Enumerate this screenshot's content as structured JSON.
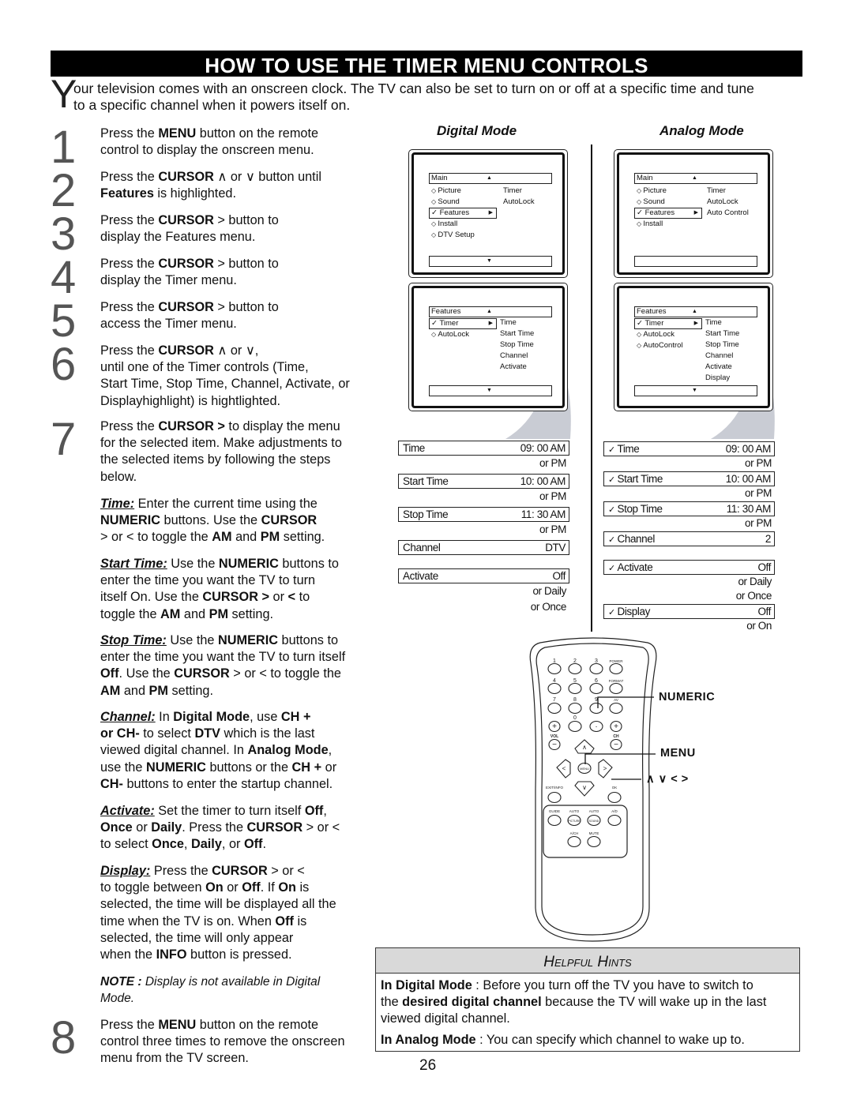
{
  "title": "HOW TO USE THE TIMER MENU CONTROLS",
  "intro": {
    "dropcap": "Y",
    "text": "our television comes with an onscreen clock. The TV can also be set to turn on or off at a specific time and tune\nto a specific channel when it powers itself on."
  },
  "steps": [
    {
      "num": "1",
      "text": [
        [
          "Press the ",
          ""
        ],
        [
          "MENU",
          "b"
        ],
        [
          " button on the remote\ncontrol to display the onscreen menu.",
          ""
        ]
      ]
    },
    {
      "num": "2",
      "text": [
        [
          "Press the ",
          ""
        ],
        [
          "CURSOR",
          "b"
        ],
        [
          " ∧  or ∨ button until\n",
          ""
        ],
        [
          "Features",
          "b"
        ],
        [
          " is highlighted.",
          ""
        ]
      ]
    },
    {
      "num": "3",
      "text": [
        [
          "Press the ",
          ""
        ],
        [
          "CURSOR",
          "b"
        ],
        [
          " > button to\ndisplay the Features menu.",
          ""
        ]
      ]
    },
    {
      "num": "4",
      "text": [
        [
          "Press the ",
          ""
        ],
        [
          "CURSOR",
          "b"
        ],
        [
          " > button to\ndisplay the Timer menu.",
          ""
        ]
      ]
    },
    {
      "num": "5",
      "text": [
        [
          "Press the ",
          ""
        ],
        [
          "CURSOR",
          "b"
        ],
        [
          " > button to\naccess the Timer menu.",
          ""
        ]
      ]
    },
    {
      "num": "6",
      "text": [
        [
          "Press the ",
          ""
        ],
        [
          "CURSOR",
          "b"
        ],
        [
          " ∧  or ∨,\nuntil one of the Timer controls (Time,\nStart Time, Stop Time, Channel, Activate, or\nDisplayhighlight) is hightlighted.",
          ""
        ]
      ]
    },
    {
      "num": "7",
      "text": [
        [
          "Press the ",
          ""
        ],
        [
          "CURSOR >",
          "b"
        ],
        [
          " to display the menu\nfor the selected item.  Make adjustments to\nthe selected items by following the steps\nbelow.",
          ""
        ]
      ]
    },
    {
      "num": "8",
      "text": [
        [
          "Press the ",
          ""
        ],
        [
          "MENU",
          "b"
        ],
        [
          " button on the remote\ncontrol three times to remove the onscreen\nmenu from the TV screen.",
          ""
        ]
      ]
    }
  ],
  "details": {
    "time": [
      [
        "Time:",
        "bu"
      ],
      [
        " Enter the current time using the\n",
        ""
      ],
      [
        "NUMERIC",
        "b"
      ],
      [
        " buttons. Use the ",
        ""
      ],
      [
        "CURSOR",
        "b"
      ],
      [
        "\n> or < to toggle the ",
        ""
      ],
      [
        "AM",
        "b"
      ],
      [
        " and ",
        ""
      ],
      [
        "PM",
        "b"
      ],
      [
        " setting.",
        ""
      ]
    ],
    "start_time": [
      [
        "Start Time:",
        "bu"
      ],
      [
        " Use the ",
        ""
      ],
      [
        "NUMERIC",
        "b"
      ],
      [
        " buttons to\nenter     the time you want the TV to turn\nitself On.  Use the ",
        ""
      ],
      [
        "CURSOR >",
        "b"
      ],
      [
        " or ",
        ""
      ],
      [
        "<",
        "b"
      ],
      [
        " to\ntoggle the ",
        ""
      ],
      [
        "AM",
        "b"
      ],
      [
        " and ",
        ""
      ],
      [
        "PM",
        "b"
      ],
      [
        " setting.",
        ""
      ]
    ],
    "stop_time": [
      [
        "Stop Time:",
        "bu"
      ],
      [
        " Use the ",
        ""
      ],
      [
        "NUMERIC",
        "b"
      ],
      [
        " buttons to\nenter the time you want the TV to turn itself\n",
        ""
      ],
      [
        "Off",
        "b"
      ],
      [
        ". Use the ",
        ""
      ],
      [
        "CURSOR",
        "b"
      ],
      [
        " > or < to toggle the\n",
        ""
      ],
      [
        "AM",
        "b"
      ],
      [
        " and ",
        ""
      ],
      [
        "PM",
        "b"
      ],
      [
        " setting.",
        ""
      ]
    ],
    "channel": [
      [
        "Channel:",
        "bu"
      ],
      [
        "  In ",
        ""
      ],
      [
        "Digital Mode",
        "b"
      ],
      [
        ", use ",
        ""
      ],
      [
        "CH +\nor CH-",
        "b"
      ],
      [
        "  to select ",
        ""
      ],
      [
        "DTV",
        "b"
      ],
      [
        " which is the last\nviewed digital channel.   In ",
        ""
      ],
      [
        "Analog Mode",
        "b"
      ],
      [
        ",\nuse the ",
        ""
      ],
      [
        "NUMERIC",
        "b"
      ],
      [
        " buttons or the ",
        ""
      ],
      [
        "CH +",
        "b"
      ],
      [
        " or\n",
        ""
      ],
      [
        "CH-",
        "b"
      ],
      [
        " buttons to enter the startup channel.",
        ""
      ]
    ],
    "activate": [
      [
        "Activate:",
        "bu"
      ],
      [
        " Set the timer to turn itself ",
        ""
      ],
      [
        "Off",
        "b"
      ],
      [
        ",\n",
        ""
      ],
      [
        "Once",
        "b"
      ],
      [
        " or ",
        ""
      ],
      [
        "Daily",
        "b"
      ],
      [
        ". Press the ",
        ""
      ],
      [
        "CURSOR",
        "b"
      ],
      [
        " > or <\nto select ",
        ""
      ],
      [
        "Once",
        "b"
      ],
      [
        ", ",
        ""
      ],
      [
        "Daily",
        "b"
      ],
      [
        ", or ",
        ""
      ],
      [
        "Off",
        "b"
      ],
      [
        ".",
        ""
      ]
    ],
    "display": [
      [
        "Display:",
        "bu"
      ],
      [
        " Press the ",
        ""
      ],
      [
        "CURSOR",
        "b"
      ],
      [
        " > or <\nto toggle between ",
        ""
      ],
      [
        "On",
        "b"
      ],
      [
        " or ",
        ""
      ],
      [
        "Off",
        "b"
      ],
      [
        ".  If ",
        ""
      ],
      [
        "On",
        "b"
      ],
      [
        " is\nselected, the time will be displayed all the\ntime when the TV is on.   When ",
        ""
      ],
      [
        "Off",
        "b"
      ],
      [
        " is\nselected, the time will only appear\nwhen the ",
        ""
      ],
      [
        "INFO",
        "b"
      ],
      [
        " button is pressed.",
        ""
      ]
    ],
    "note": [
      [
        "NOTE :",
        "bi"
      ],
      [
        " Display is not available in Digital\nMode.",
        "i"
      ]
    ]
  },
  "modes": {
    "digital": "Digital Mode",
    "analog": "Analog Mode"
  },
  "screens": {
    "digital_main": {
      "header": "Main",
      "items": [
        [
          "◇",
          "Picture",
          false
        ],
        [
          "◇",
          "Sound",
          false
        ],
        [
          "✓",
          "Features",
          true
        ],
        [
          "◇",
          "Install",
          false
        ],
        [
          "◇",
          "DTV Setup",
          false
        ]
      ],
      "right": [
        "Timer",
        "AutoLock"
      ],
      "bottom_arrow": true
    },
    "digital_features": {
      "header": "Features",
      "items": [
        [
          "✓",
          "Timer",
          true
        ],
        [
          "◇",
          "AutoLock",
          false
        ]
      ],
      "right": [
        "Time",
        "Start Time",
        "Stop Time",
        "Channel",
        "Activate"
      ],
      "bottom_arrow": true
    },
    "analog_main": {
      "header": "Main",
      "items": [
        [
          "◇",
          "Picture",
          false
        ],
        [
          "◇",
          "Sound",
          false
        ],
        [
          "✓",
          "Features",
          true
        ],
        [
          "◇",
          "Install",
          false
        ]
      ],
      "right": [
        "Timer",
        "AutoLock",
        "Auto Control"
      ],
      "bottom_arrow": false
    },
    "analog_features": {
      "header": "Features",
      "items": [
        [
          "✓",
          "Timer",
          true
        ],
        [
          "◇",
          "AutoLock",
          false
        ],
        [
          "◇",
          "AutoControl",
          false
        ]
      ],
      "right": [
        "Time",
        "Start Time",
        "Stop Time",
        "Channel",
        "Activate",
        "Display"
      ],
      "bottom_arrow": true
    }
  },
  "settings": {
    "digital": [
      {
        "label": "Time",
        "value": "09: 00 AM",
        "alts": [
          "or PM"
        ]
      },
      {
        "label": "Start Time",
        "value": "10: 00 AM",
        "alts": [
          "or PM"
        ]
      },
      {
        "label": "Stop Time",
        "value": "11: 30 AM",
        "alts": [
          "or PM"
        ]
      },
      {
        "label": "Channel",
        "value": "DTV",
        "alts": []
      },
      {
        "label": "Activate",
        "value": "Off",
        "alts": [
          "or Daily",
          "or Once"
        ]
      }
    ],
    "analog": [
      {
        "label": "Time",
        "value": "09: 00 AM",
        "alts": [
          "or PM"
        ]
      },
      {
        "label": "Start Time",
        "value": "10: 00 AM",
        "alts": [
          "or PM"
        ]
      },
      {
        "label": "Stop Time",
        "value": "11: 30 AM",
        "alts": [
          "or PM"
        ]
      },
      {
        "label": "Channel",
        "value": "2",
        "alts": []
      },
      {
        "label": "Activate",
        "value": "Off",
        "alts": [
          "or Daily",
          "or Once"
        ]
      },
      {
        "label": "Display",
        "value": "Off",
        "alts": [
          "or On"
        ]
      }
    ],
    "check_mark": "✓"
  },
  "remote": {
    "keys": {
      "k1": "1",
      "k2": "2",
      "k3": "3",
      "power": "POWER",
      "k4": "4",
      "k5": "5",
      "k6": "6",
      "format": "FORMAT",
      "k7": "7",
      "k8": "8",
      "k9": "9",
      "av": "AV",
      "k0": "0",
      "dot": "·",
      "vol": "VOL",
      "ch": "CH",
      "menu": "MENU",
      "exit_info": "EXIT/INFO",
      "ok": "OK",
      "guide": "GUIDE",
      "auto1": "AUTO",
      "auto2": "AUTO",
      "ad": "A/D",
      "picture": "PICTURE",
      "sound": "SOUND",
      "ach": "A/CH",
      "mute": "MUTE"
    },
    "callouts": {
      "numeric": "NUMERIC",
      "menu": "MENU",
      "cursor": "∧  ∨  <  >"
    }
  },
  "hints": {
    "title": "Helpful Hints",
    "digital": [
      [
        "In Digital Mode",
        "b"
      ],
      [
        " :  Before you turn off the TV you have to switch to\nthe ",
        ""
      ],
      [
        "desired digital channel",
        "b"
      ],
      [
        " because the TV will wake up in the last\nviewed digital channel.",
        ""
      ]
    ],
    "analog": [
      [
        "In Analog Mode",
        "b"
      ],
      [
        "  :  You can specify which channel to wake up to.",
        ""
      ]
    ]
  },
  "page_number": "26"
}
